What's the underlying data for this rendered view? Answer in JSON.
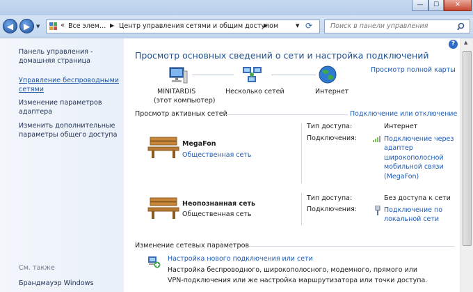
{
  "window": {
    "min": "—",
    "max": "☐",
    "close": "✕"
  },
  "address": {
    "breadcrumb_1": "Все элем…",
    "breadcrumb_2": "Центр управления сетями и общим доступом",
    "search_placeholder": "Поиск в панели управления"
  },
  "sidebar": {
    "home_line1": "Панель управления -",
    "home_line2": "домашняя страница",
    "wireless_line1": "Управление беспроводными",
    "wireless_line2": "сетями",
    "adapter_line1": "Изменение параметров",
    "adapter_line2": "адаптера",
    "sharing_line1": "Изменить дополнительные",
    "sharing_line2": "параметры общего доступа",
    "see_also": "См. также",
    "firewall": "Брандмауэр Windows"
  },
  "main": {
    "title": "Просмотр основных сведений о сети и настройка подключений",
    "full_map": "Просмотр полной карты",
    "map": {
      "computer_name": "MINITARDIS",
      "computer_sub": "(этот компьютер)",
      "multiple": "Несколько сетей",
      "internet": "Интернет"
    },
    "active_title": "Просмотр активных сетей",
    "connect_disconnect": "Подключение или отключение",
    "networks": [
      {
        "name": "MegaFon",
        "type": "Общественная сеть",
        "access_label": "Тип доступа:",
        "access_value": "Интернет",
        "conn_label": "Подключения:",
        "conn_line1": "Подключение через",
        "conn_line2": "адаптер",
        "conn_line3": "широкополосной",
        "conn_line4": "мобильной связи",
        "conn_line5": "(MegaFon)"
      },
      {
        "name": "Неопознанная сеть",
        "type": "Общественная сеть",
        "access_label": "Тип доступа:",
        "access_value": "Без доступа к сети",
        "conn_label": "Подключения:",
        "conn_line1": "Подключение по",
        "conn_line2": "локальной сети"
      }
    ],
    "change_title": "Изменение сетевых параметров",
    "setup_link": "Настройка нового подключения или сети",
    "setup_desc1": "Настройка беспроводного, широкополосного, модемного, прямого или",
    "setup_desc2": "VPN-подключения или же настройка маршрутизатора или точки доступа."
  }
}
